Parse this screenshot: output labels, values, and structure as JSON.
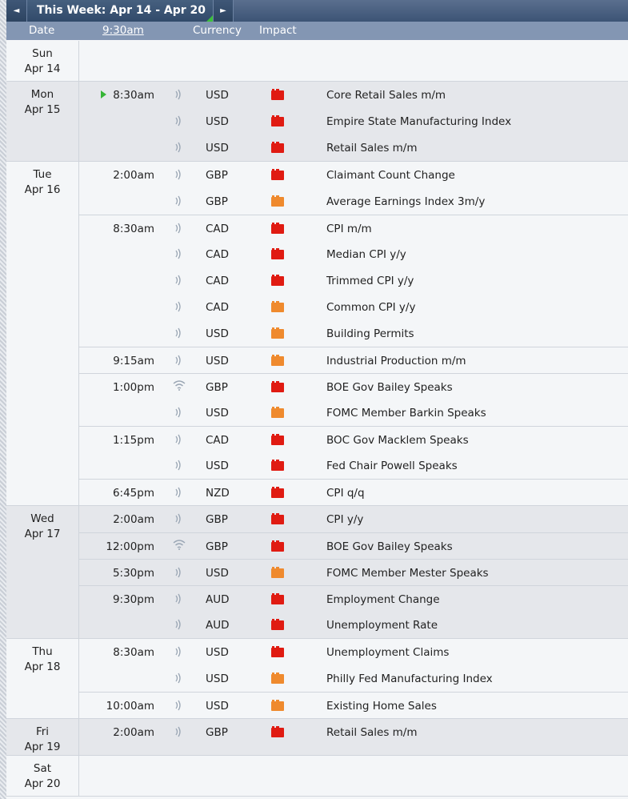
{
  "toolbar": {
    "week_title": "This Week: Apr 14 - Apr 20",
    "prev_icon": "◄",
    "next_icon": "►"
  },
  "columns": {
    "date": "Date",
    "time": "9:30am",
    "currency": "Currency",
    "impact": "Impact"
  },
  "colors": {
    "high": "#e01b12",
    "medium": "#ef8a2e"
  },
  "days": [
    {
      "dow": "Sun",
      "date": "Apr 14",
      "events": []
    },
    {
      "dow": "Mon",
      "date": "Apr 15",
      "events": [
        {
          "time": "8:30am",
          "next": true,
          "icon": "sound-icon",
          "currency": "USD",
          "impact": "high",
          "title": "Core Retail Sales m/m"
        },
        {
          "time": "",
          "icon": "sound-icon",
          "currency": "USD",
          "impact": "high",
          "title": "Empire State Manufacturing Index"
        },
        {
          "time": "",
          "icon": "sound-icon",
          "currency": "USD",
          "impact": "high",
          "title": "Retail Sales m/m"
        }
      ]
    },
    {
      "dow": "Tue",
      "date": "Apr 16",
      "events": [
        {
          "time": "2:00am",
          "icon": "sound-icon",
          "currency": "GBP",
          "impact": "high",
          "title": "Claimant Count Change"
        },
        {
          "time": "",
          "icon": "sound-icon",
          "currency": "GBP",
          "impact": "medium",
          "title": "Average Earnings Index 3m/y"
        },
        {
          "time": "8:30am",
          "icon": "sound-icon",
          "currency": "CAD",
          "impact": "high",
          "title": "CPI m/m"
        },
        {
          "time": "",
          "icon": "sound-icon",
          "currency": "CAD",
          "impact": "high",
          "title": "Median CPI y/y"
        },
        {
          "time": "",
          "icon": "sound-icon",
          "currency": "CAD",
          "impact": "high",
          "title": "Trimmed CPI y/y"
        },
        {
          "time": "",
          "icon": "sound-icon",
          "currency": "CAD",
          "impact": "medium",
          "title": "Common CPI y/y"
        },
        {
          "time": "",
          "icon": "sound-icon",
          "currency": "USD",
          "impact": "medium",
          "title": "Building Permits"
        },
        {
          "time": "9:15am",
          "icon": "sound-icon",
          "currency": "USD",
          "impact": "medium",
          "title": "Industrial Production m/m"
        },
        {
          "time": "1:00pm",
          "icon": "wifi-icon",
          "currency": "GBP",
          "impact": "high",
          "title": "BOE Gov Bailey Speaks"
        },
        {
          "time": "",
          "icon": "sound-icon",
          "currency": "USD",
          "impact": "medium",
          "title": "FOMC Member Barkin Speaks"
        },
        {
          "time": "1:15pm",
          "icon": "sound-icon",
          "currency": "CAD",
          "impact": "high",
          "title": "BOC Gov Macklem Speaks"
        },
        {
          "time": "",
          "icon": "sound-icon",
          "currency": "USD",
          "impact": "high",
          "title": "Fed Chair Powell Speaks"
        },
        {
          "time": "6:45pm",
          "icon": "sound-icon",
          "currency": "NZD",
          "impact": "high",
          "title": "CPI q/q"
        }
      ]
    },
    {
      "dow": "Wed",
      "date": "Apr 17",
      "events": [
        {
          "time": "2:00am",
          "icon": "sound-icon",
          "currency": "GBP",
          "impact": "high",
          "title": "CPI y/y"
        },
        {
          "time": "12:00pm",
          "icon": "wifi-icon",
          "currency": "GBP",
          "impact": "high",
          "title": "BOE Gov Bailey Speaks"
        },
        {
          "time": "5:30pm",
          "icon": "sound-icon",
          "currency": "USD",
          "impact": "medium",
          "title": "FOMC Member Mester Speaks"
        },
        {
          "time": "9:30pm",
          "icon": "sound-icon",
          "currency": "AUD",
          "impact": "high",
          "title": "Employment Change"
        },
        {
          "time": "",
          "icon": "sound-icon",
          "currency": "AUD",
          "impact": "high",
          "title": "Unemployment Rate"
        }
      ]
    },
    {
      "dow": "Thu",
      "date": "Apr 18",
      "events": [
        {
          "time": "8:30am",
          "icon": "sound-icon",
          "currency": "USD",
          "impact": "high",
          "title": "Unemployment Claims"
        },
        {
          "time": "",
          "icon": "sound-icon",
          "currency": "USD",
          "impact": "medium",
          "title": "Philly Fed Manufacturing Index"
        },
        {
          "time": "10:00am",
          "icon": "sound-icon",
          "currency": "USD",
          "impact": "medium",
          "title": "Existing Home Sales"
        }
      ]
    },
    {
      "dow": "Fri",
      "date": "Apr 19",
      "events": [
        {
          "time": "2:00am",
          "icon": "sound-icon",
          "currency": "GBP",
          "impact": "high",
          "title": "Retail Sales m/m"
        }
      ]
    },
    {
      "dow": "Sat",
      "date": "Apr 20",
      "events": []
    }
  ]
}
